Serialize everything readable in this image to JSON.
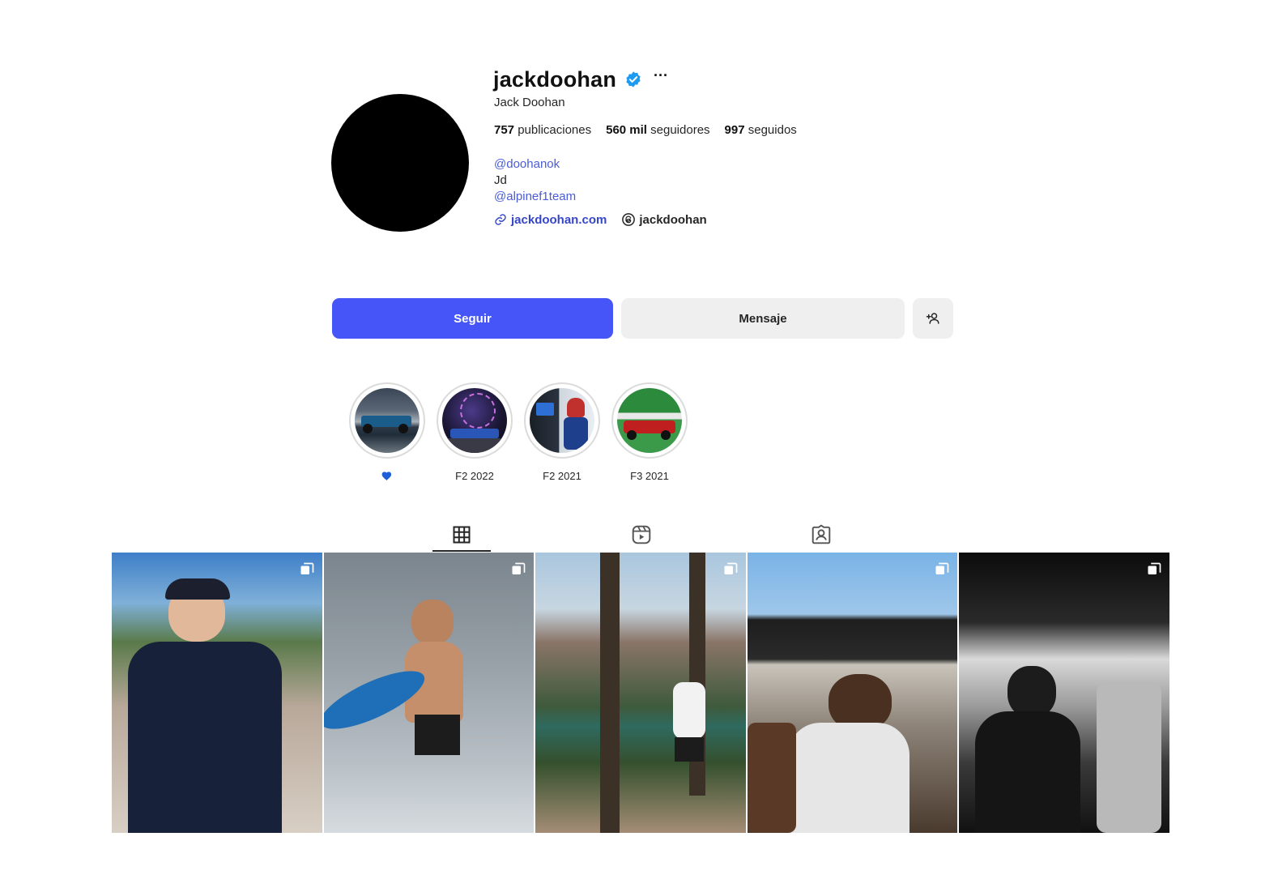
{
  "profile": {
    "username": "jackdoohan",
    "verified_icon": "verified-badge-icon",
    "more_label": "···",
    "full_name": "Jack Doohan",
    "stats": {
      "posts_count": "757",
      "posts_label": "publicaciones",
      "followers_count": "560 mil",
      "followers_label": "seguidores",
      "following_count": "997",
      "following_label": "seguidos"
    },
    "bio": {
      "line1": "@doohanok",
      "line2": "Jd",
      "line3": "@alpinef1team"
    },
    "links": {
      "website": "jackdoohan.com",
      "threads": "jackdoohan"
    }
  },
  "actions": {
    "follow_label": "Seguir",
    "message_label": "Mensaje",
    "add_icon": "add-person-icon"
  },
  "highlights": [
    {
      "label": "",
      "icon": "heart-icon"
    },
    {
      "label": "F2 2022"
    },
    {
      "label": "F2 2021"
    },
    {
      "label": "F3 2021"
    }
  ],
  "tabs": [
    {
      "icon": "grid-icon",
      "active": true
    },
    {
      "icon": "reels-icon",
      "active": false
    },
    {
      "icon": "tagged-icon",
      "active": false
    }
  ],
  "colors": {
    "primary": "#4555f7",
    "link": "#3546c8",
    "verified": "#1d9bf0"
  }
}
